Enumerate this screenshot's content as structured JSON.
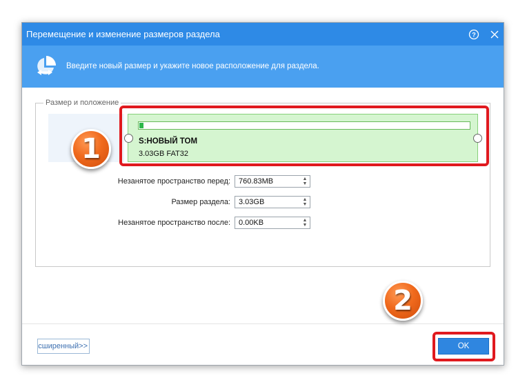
{
  "window": {
    "title": "Перемещение и изменение размеров раздела",
    "help_icon": "help-circle-icon",
    "close_icon": "close-icon"
  },
  "header": {
    "icon": "partition-move-icon",
    "text": "Введите новый размер и укажите новое расположение для раздела."
  },
  "group": {
    "legend": "Размер и положение"
  },
  "partition": {
    "name": "S:НОВЫЙ ТОМ",
    "info": "3.03GB FAT32",
    "used_fraction": 0.012,
    "fill_color": "#2db84a",
    "background_color": "#d5f5d0"
  },
  "fields": [
    {
      "label": "Незанятое пространство перед:",
      "value": "760.83MB"
    },
    {
      "label": "Размер раздела:",
      "value": "3.03GB"
    },
    {
      "label": "Незанятое пространство после:",
      "value": "0.00KB"
    }
  ],
  "buttons": {
    "advanced": "Расширенный>>",
    "ok": "OK"
  },
  "annotations": {
    "badge1": "1",
    "badge2": "2",
    "highlight_color": "#e0191e"
  },
  "colors": {
    "titlebar": "#2e8ae6",
    "header": "#4aa0f0",
    "ok_button": "#2f86e0"
  }
}
